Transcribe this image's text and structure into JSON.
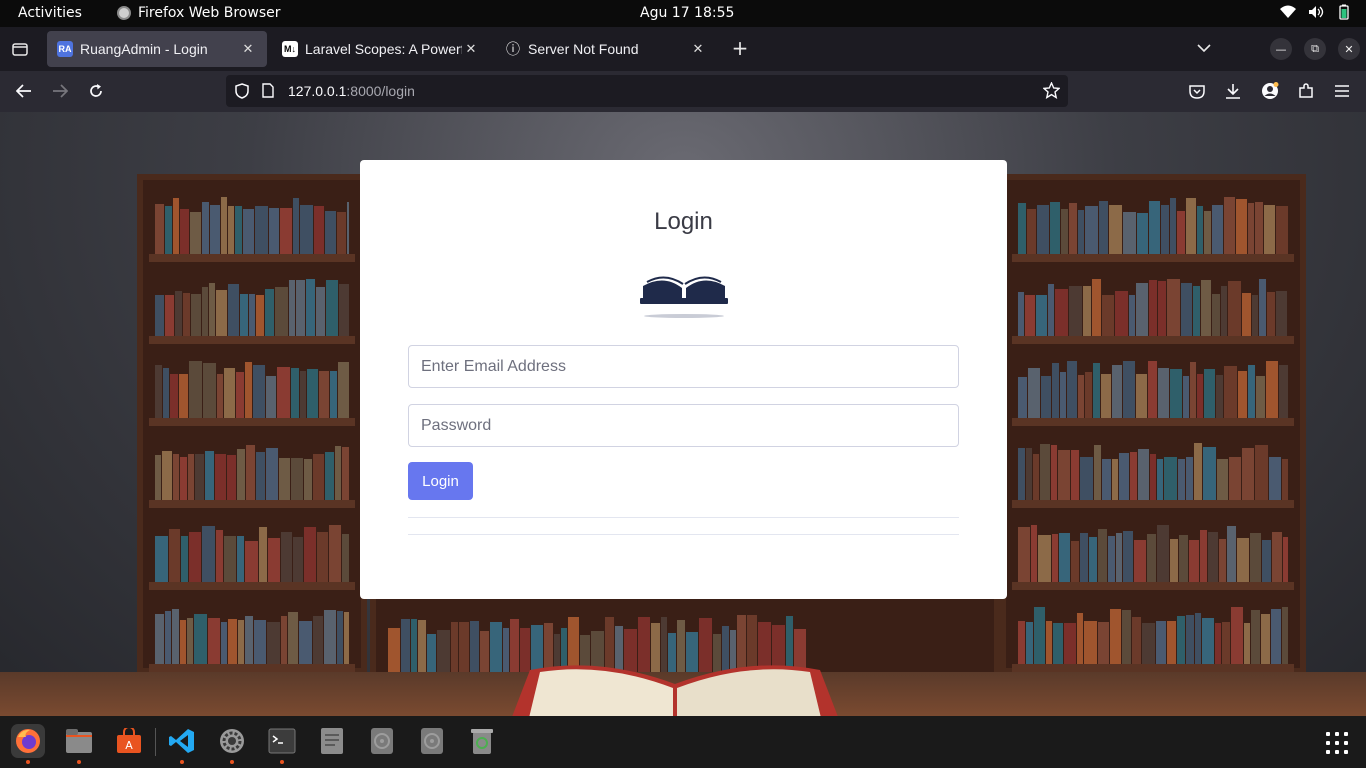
{
  "topbar": {
    "activities": "Activities",
    "app_name": "Firefox Web Browser",
    "clock": "Agu 17  18:55"
  },
  "tabs": [
    {
      "favicon": "RA",
      "title": "RuangAdmin - Login",
      "active": true
    },
    {
      "favicon": "M↓",
      "title": "Laravel Scopes: A Powerf",
      "active": false
    },
    {
      "favicon": "ⓘ",
      "title": "Server Not Found",
      "active": false
    }
  ],
  "navbar": {
    "url_host": "127.0.0.1",
    "url_rest": ":8000/login"
  },
  "login": {
    "title": "Login",
    "email_placeholder": "Enter Email Address",
    "password_placeholder": "Password",
    "button_label": "Login",
    "accent_color": "#6777ef"
  },
  "dock": {
    "items": [
      "firefox-icon",
      "files-icon",
      "app-center-icon",
      "vscode-icon",
      "settings-icon",
      "terminal-icon",
      "text-editor-icon",
      "disk-icon",
      "disk-icon",
      "trash-icon"
    ]
  }
}
